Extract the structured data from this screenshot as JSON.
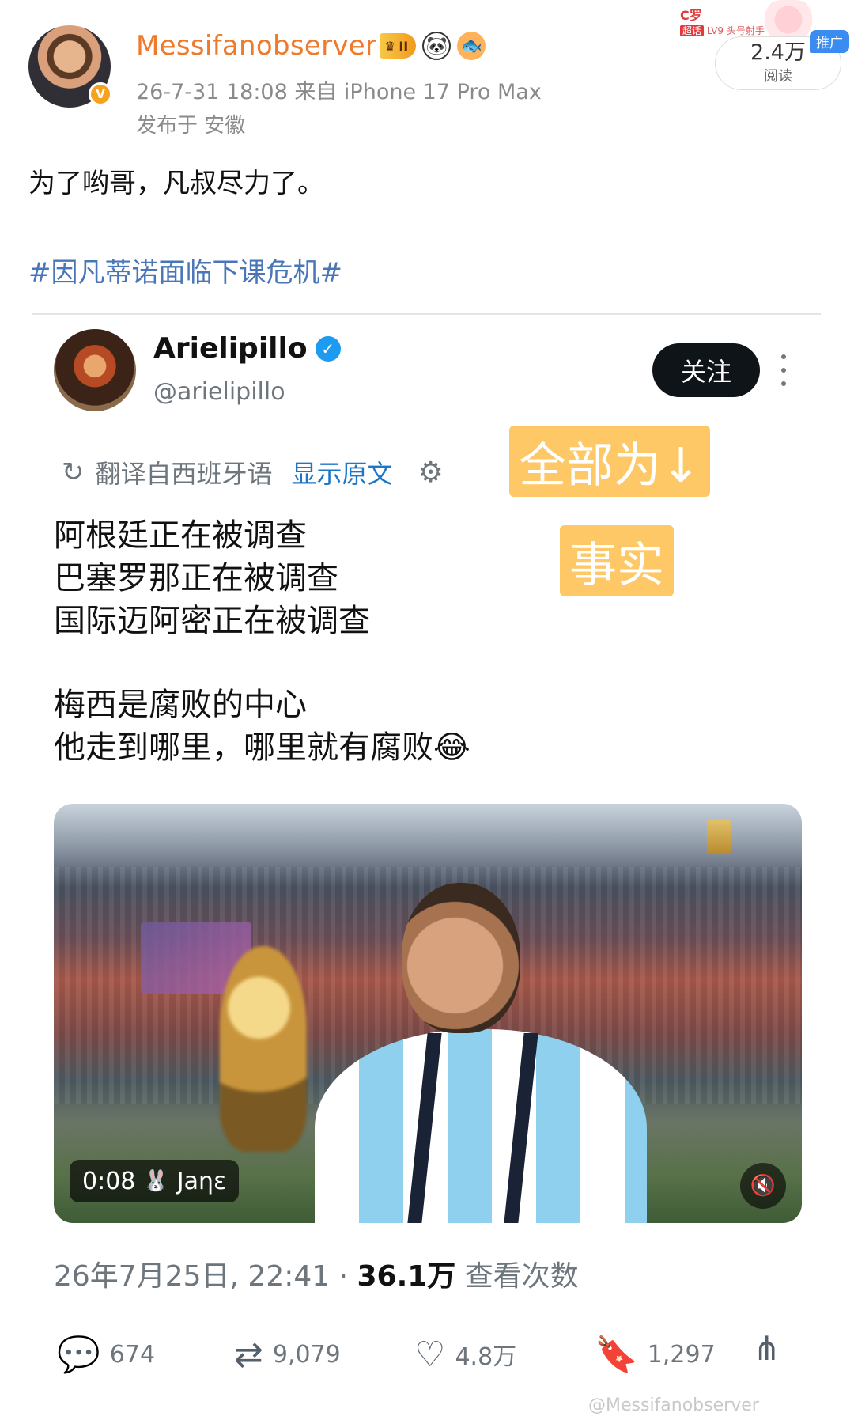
{
  "post": {
    "username": "Messifanobserver",
    "vip_badge": "II",
    "meta": "26-7-31 18:08  来自 iPhone 17 Pro Max",
    "location": "发布于 安徽",
    "text": "为了哟哥，凡叔尽力了。",
    "hashtag": "#因凡蒂诺面临下课危机#"
  },
  "promo": {
    "title": "C罗",
    "level": "LV9 头号射手",
    "level_tag": "超话",
    "read_count": "2.4万",
    "read_label": "阅读",
    "tag": "推广"
  },
  "tweet": {
    "name": "Arielipillo",
    "handle": "@arielipillo",
    "follow": "关注",
    "translate": "翻译自西班牙语",
    "show_original": "显示原文",
    "lines": [
      "阿根廷正在被调查",
      "巴塞罗那正在被调查",
      "国际迈阿密正在被调查",
      "梅西是腐败的中心",
      "他走到哪里，哪里就有腐败😂"
    ],
    "video_time": "0:08",
    "video_credit": "Jaηε",
    "date": "26年7月25日, 22:41 · ",
    "views": "36.1万",
    "views_label": " 查看次数",
    "replies": "674",
    "retweets": "9,079",
    "likes": "4.8万",
    "bookmarks": "1,297"
  },
  "annotations": {
    "note1": "全部为↓",
    "note2": "事实"
  },
  "watermark": "@Messifanobserver",
  "colors": {
    "username": "#ef7a2b",
    "hashtag": "#4a76b8",
    "note_bg": "#ffc866",
    "x_blue": "#1d9bf0"
  }
}
